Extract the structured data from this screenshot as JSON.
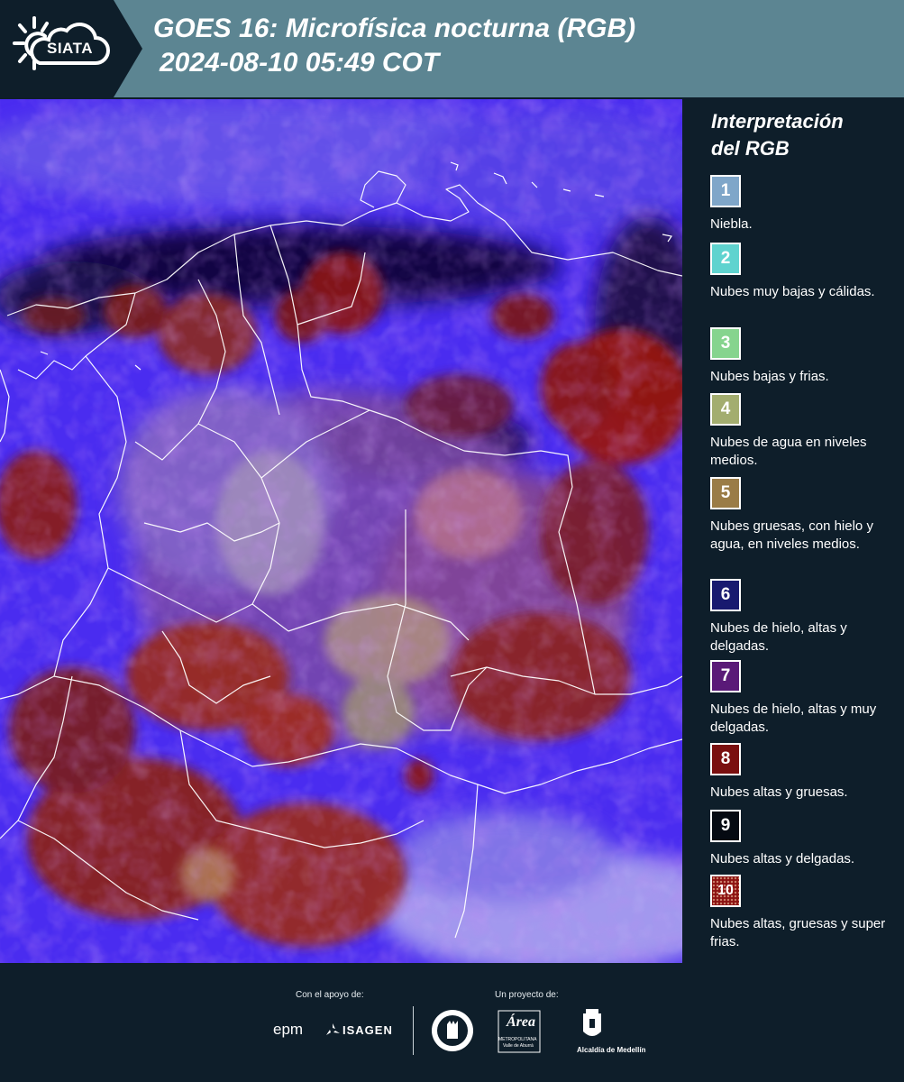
{
  "header": {
    "logo_text": "SIATA",
    "title_line1": "GOES 16: Microfísica nocturna (RGB)",
    "title_line2": "2024-08-10 05:49 COT"
  },
  "legend": {
    "title_line1": "Interpretación",
    "title_line2": "del RGB",
    "items": [
      {
        "number": "1",
        "color": "#7fa6c9",
        "text": "Niebla."
      },
      {
        "number": "2",
        "color": "#5fd3cf",
        "text": "Nubes muy bajas y cálidas."
      },
      {
        "number": "3",
        "color": "#86d48e",
        "text": "Nubes bajas y frias."
      },
      {
        "number": "4",
        "color": "#a3ad6f",
        "text": "Nubes de agua en niveles medios."
      },
      {
        "number": "5",
        "color": "#9a7c47",
        "text": "Nubes gruesas, con hielo y agua, en niveles medios."
      },
      {
        "number": "6",
        "color": "#181a6f",
        "text": "Nubes de hielo, altas y delgadas."
      },
      {
        "number": "7",
        "color": "#5a1a78",
        "text": "Nubes de hielo, altas y muy delgadas."
      },
      {
        "number": "8",
        "color": "#7a0f0f",
        "text": "Nubes altas y gruesas."
      },
      {
        "number": "9",
        "color": "#050a12",
        "text": "Nubes altas y delgadas."
      },
      {
        "number": "10",
        "color": "#8c1212",
        "text": "Nubes altas, gruesas y super frias."
      }
    ]
  },
  "footer": {
    "support_label": "Con el apoyo de:",
    "project_label": "Un proyecto de:",
    "epm_text": "epm",
    "isagen_text": "ISAGEN",
    "area_text": "Área",
    "area_sub1": "METROPOLITANA",
    "area_sub2": "Valle de Aburrá",
    "alcaldia_text": "Alcaldía de Medellín"
  }
}
